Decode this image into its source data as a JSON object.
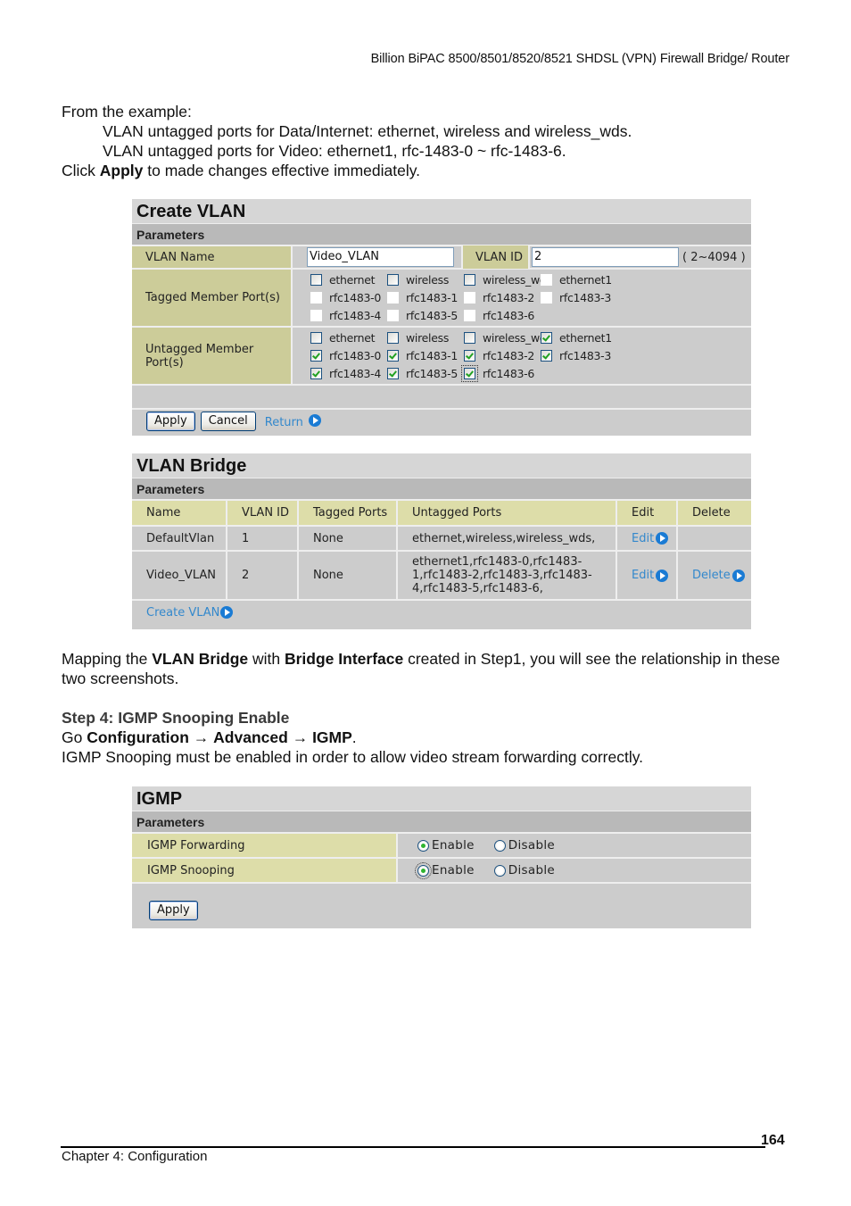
{
  "header": {
    "title": "Billion BiPAC 8500/8501/8520/8521 SHDSL (VPN) Firewall Bridge/ Router"
  },
  "intro": {
    "line1": "From the example:",
    "line2": "VLAN untagged ports for Data/Internet: ethernet, wireless and wireless_wds.",
    "line3": "VLAN untagged ports for Video: ethernet1, rfc-1483-0 ~ rfc-1483-6.",
    "line4_prefix": "Click ",
    "line4_bold": "Apply",
    "line4_suffix": " to made changes effective immediately."
  },
  "create_vlan": {
    "title": "Create VLAN",
    "subtitle": "Parameters",
    "vlan_name_label": "VLAN Name",
    "vlan_name_value": "Video_VLAN",
    "vlan_id_label": "VLAN ID",
    "vlan_id_value": "2",
    "vlan_id_range": "( 2~4094 )",
    "tagged_label": "Tagged Member Port(s)",
    "untagged_label": "Untagged Member Port(s)",
    "tagged_ports": [
      {
        "label": "ethernet",
        "checked": false
      },
      {
        "label": "wireless",
        "checked": false
      },
      {
        "label": "wireless_wds",
        "checked": false
      },
      {
        "label": "ethernet1",
        "checked": false
      },
      {
        "label": "rfc1483-0",
        "checked": false
      },
      {
        "label": "rfc1483-1",
        "checked": false
      },
      {
        "label": "rfc1483-2",
        "checked": false
      },
      {
        "label": "rfc1483-3",
        "checked": false
      },
      {
        "label": "rfc1483-4",
        "checked": false
      },
      {
        "label": "rfc1483-5",
        "checked": false
      },
      {
        "label": "rfc1483-6",
        "checked": false
      }
    ],
    "untagged_ports": [
      {
        "label": "ethernet",
        "checked": false
      },
      {
        "label": "wireless",
        "checked": false
      },
      {
        "label": "wireless_wds",
        "checked": false
      },
      {
        "label": "ethernet1",
        "checked": true
      },
      {
        "label": "rfc1483-0",
        "checked": true
      },
      {
        "label": "rfc1483-1",
        "checked": true
      },
      {
        "label": "rfc1483-2",
        "checked": true
      },
      {
        "label": "rfc1483-3",
        "checked": true
      },
      {
        "label": "rfc1483-4",
        "checked": true
      },
      {
        "label": "rfc1483-5",
        "checked": true
      },
      {
        "label": "rfc1483-6",
        "checked": true
      }
    ],
    "apply_label": "Apply",
    "cancel_label": "Cancel",
    "return_label": "Return"
  },
  "vlan_bridge": {
    "title": "VLAN Bridge",
    "subtitle": "Parameters",
    "columns": [
      "Name",
      "VLAN ID",
      "Tagged Ports",
      "Untagged Ports",
      "Edit",
      "Delete"
    ],
    "rows": [
      {
        "name": "DefaultVlan",
        "vlan_id": "1",
        "tagged": "None",
        "untagged": "ethernet,wireless,wireless_wds,",
        "edit": "Edit",
        "delete": ""
      },
      {
        "name": "Video_VLAN",
        "vlan_id": "2",
        "tagged": "None",
        "untagged_lines": [
          "ethernet1,rfc1483-0,rfc1483-",
          "1,rfc1483-2,rfc1483-3,rfc1483-",
          "4,rfc1483-5,rfc1483-6,"
        ],
        "edit": "Edit",
        "delete": "Delete"
      }
    ],
    "create_label": "Create VLAN"
  },
  "mapping": {
    "p1": "Mapping the ",
    "b1": "VLAN Bridge",
    "p2": " with ",
    "b2": "Bridge Interface",
    "p3": " created in Step1, you will see the relationship in these two screenshots."
  },
  "step4": {
    "heading": "Step 4: IGMP Snooping Enable",
    "go_prefix": "Go ",
    "go_b1": "Configuration",
    "arrow": "→",
    "go_b2": "Advanced",
    "go_b3": "IGMP",
    "go_suffix": ".",
    "desc": "IGMP Snooping must be enabled in order to allow video stream forwarding correctly."
  },
  "igmp": {
    "title": "IGMP",
    "subtitle": "Parameters",
    "rows": [
      {
        "label": "IGMP Forwarding",
        "enable": "Enable",
        "disable": "Disable",
        "selected": "Enable"
      },
      {
        "label": "IGMP Snooping",
        "enable": "Enable",
        "disable": "Disable",
        "selected": "Enable"
      }
    ],
    "apply_label": "Apply"
  },
  "footer": {
    "chapter": "Chapter 4: Configuration",
    "page": "164"
  }
}
